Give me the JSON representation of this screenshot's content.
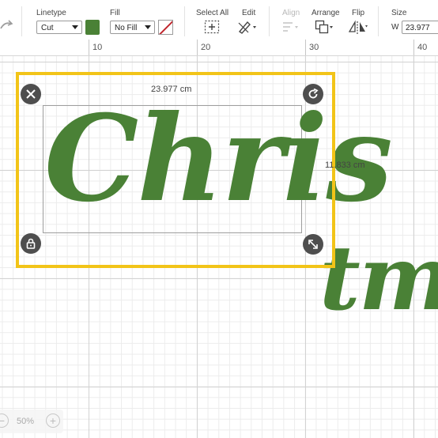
{
  "toolbar": {
    "linetype": {
      "label": "Linetype",
      "value": "Cut"
    },
    "fill": {
      "label": "Fill",
      "value": "No Fill"
    },
    "select_all": {
      "label": "Select All"
    },
    "edit": {
      "label": "Edit"
    },
    "align": {
      "label": "Align"
    },
    "arrange": {
      "label": "Arrange"
    },
    "flip": {
      "label": "Flip"
    },
    "size": {
      "label": "Size",
      "w_label": "W",
      "w_value": "23.977"
    },
    "colors": {
      "linetype_swatch": "#4a8136",
      "no_fill_slash": "#c0262d"
    }
  },
  "ruler": {
    "marks": [
      "10",
      "20",
      "30",
      "40"
    ]
  },
  "canvas": {
    "selection": {
      "width_label": "23.977 cm",
      "height_label": "11.833 cm",
      "border_color": "#f2c418",
      "handles": [
        "close-icon",
        "rotate-icon",
        "lock-icon",
        "resize-icon"
      ]
    },
    "text_layers": [
      {
        "text": "Chris",
        "color": "#4a8136"
      },
      {
        "text": "tma",
        "color": "#4a8136"
      }
    ]
  },
  "zoom": {
    "minus": "−",
    "level": "50%",
    "plus": "+"
  }
}
